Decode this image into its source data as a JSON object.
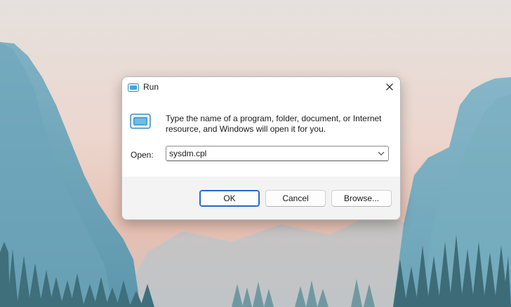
{
  "dialog": {
    "title": "Run",
    "title_icon": "run-icon",
    "close_icon": "close-icon",
    "description": "Type the name of a program, folder, document, or Internet resource, and Windows will open it for you.",
    "open_label": "Open:",
    "input_value": "sysdm.cpl",
    "dropdown_icon": "chevron-down-icon",
    "buttons": {
      "ok": "OK",
      "cancel": "Cancel",
      "browse": "Browse..."
    }
  },
  "colors": {
    "accent": "#2a66c8",
    "footer_bg": "#f3f3f3",
    "dialog_bg": "#ffffff"
  }
}
